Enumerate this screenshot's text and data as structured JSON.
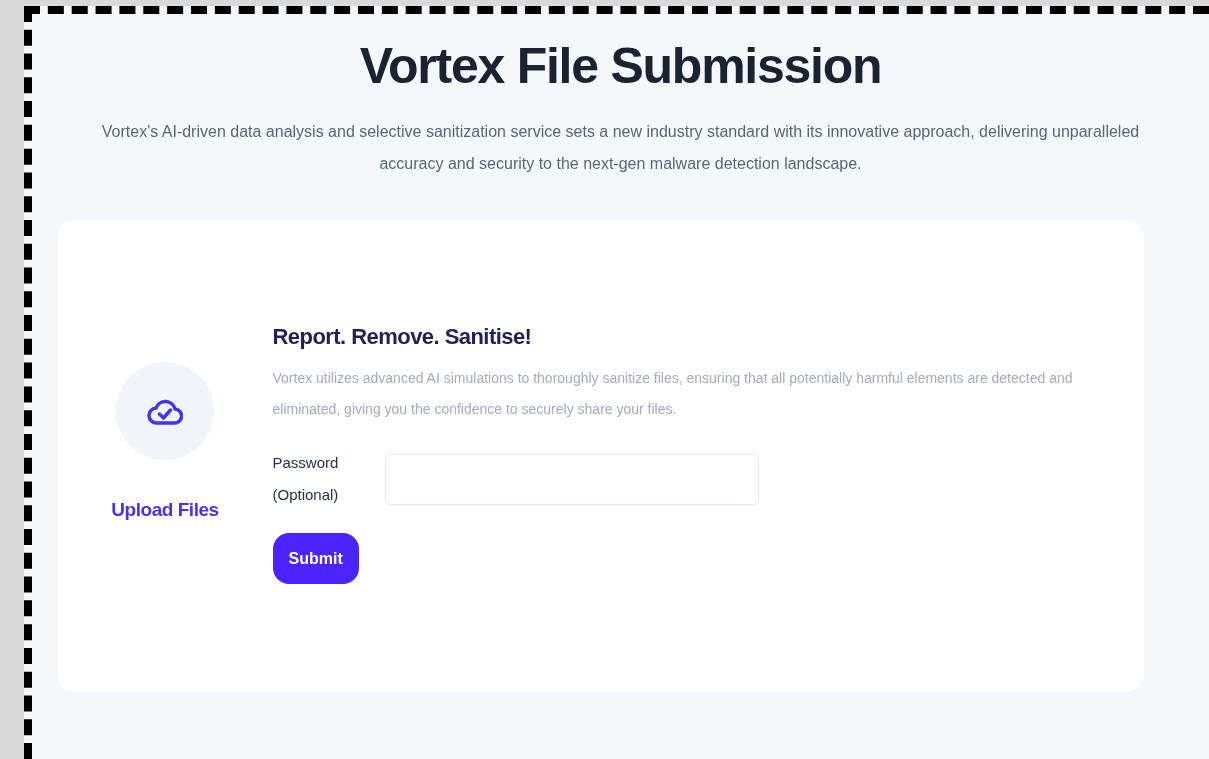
{
  "page": {
    "title": "Vortex File Submission",
    "subtitle": "Vortex's AI-driven data analysis and selective sanitization service sets a new industry standard with its innovative approach, delivering unparalleled accuracy and security to the next-gen malware detection landscape."
  },
  "card": {
    "upload": {
      "label": "Upload Files"
    },
    "heading": "Report. Remove. Sanitise!",
    "description": "Vortex utilizes advanced AI simulations to thoroughly sanitize files, ensuring that all potentially harmful elements are detected and eliminated, giving you the confidence to securely share your files.",
    "password_field": {
      "label_lines": [
        "Password",
        "(Optional)"
      ]
    },
    "buttons": [
      "Submit"
    ]
  }
}
